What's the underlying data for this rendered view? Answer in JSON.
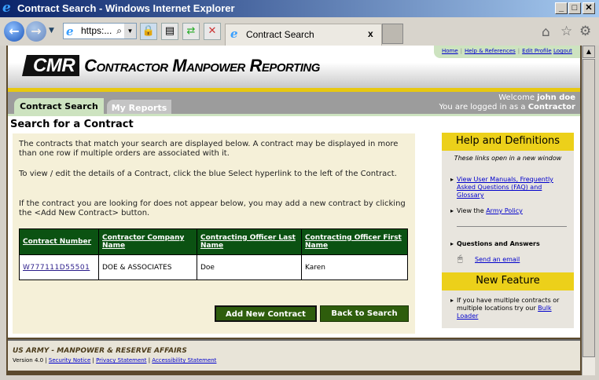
{
  "window": {
    "title": "Contract Search - Windows Internet Explorer"
  },
  "browser": {
    "address": "https:...",
    "tab_title": "Contract Search",
    "tab_close": "x"
  },
  "header": {
    "logo_text": "CMR",
    "site_title": "Contractor Manpower Reporting",
    "links": [
      "Home",
      "Help & References",
      "Edit Profile",
      "Logout"
    ]
  },
  "tabs": [
    "Contract Search",
    "My Reports"
  ],
  "user": {
    "welcome": "Welcome",
    "name": "john doe",
    "role_prefix": "You are logged in as a",
    "role": "Contractor"
  },
  "main": {
    "title": "Search for a Contract",
    "paragraphs": [
      "The contracts that match your search are displayed below. A contract may be displayed in more than one row if multiple orders are associated with it.",
      "To view / edit the details of a Contract, click the blue Select hyperlink to the left of the Contract.",
      "If the contract you are looking for does not appear below, you may add a new contract by clicking the <Add New Contract> button."
    ],
    "table": {
      "headers": [
        "Contract Number",
        "Contractor Company Name",
        "Contracting Officer Last Name",
        "Contracting Officer First Name"
      ],
      "rows": [
        [
          "W777111D55501",
          "DOE & ASSOCIATES",
          "Doe",
          "Karen"
        ]
      ]
    },
    "add_button": "Add New Contract",
    "back_button": "Back to Search"
  },
  "side": {
    "help_title": "Help and Definitions",
    "note": "These links open in a new window",
    "manuals_link": "View User Manuals, Frequently Asked Questions (FAQ) and Glossary",
    "view_the": "View the",
    "army_policy": "Army Policy",
    "qa": "Questions and Answers",
    "email": "Send an email",
    "feature_title": "New Feature",
    "feature_text": "If you have multiple contracts or multiple locations try our",
    "bulk_loader": "Bulk Loader"
  },
  "footer": {
    "org": "US ARMY - MANPOWER & RESERVE AFFAIRS",
    "version": "Version 4.0",
    "links": [
      "Security Notice",
      "Privacy Statement",
      "Accessibility Statement"
    ]
  }
}
